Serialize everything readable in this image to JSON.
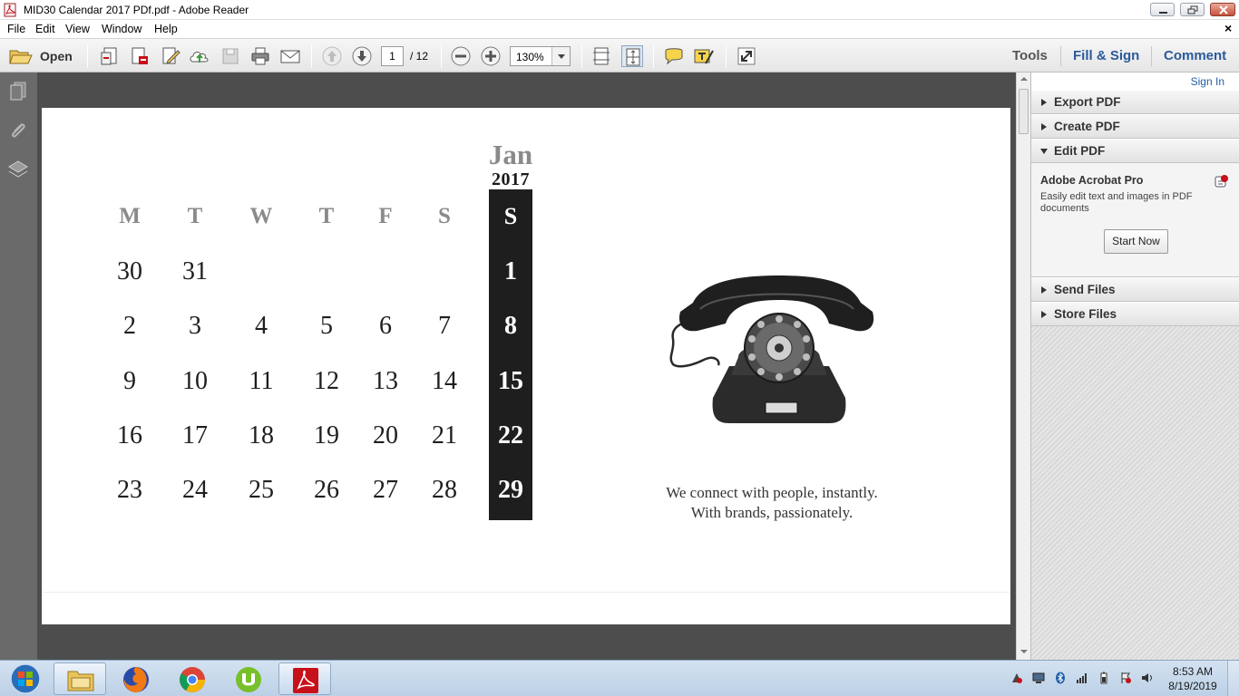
{
  "window": {
    "title": "MID30 Calendar 2017 PDf.pdf - Adobe Reader"
  },
  "menu": {
    "items": [
      "File",
      "Edit",
      "View",
      "Window",
      "Help"
    ],
    "close_glyph": "×"
  },
  "toolbar": {
    "open_label": "Open",
    "page_current": "1",
    "page_total": "/ 12",
    "zoom": "130%",
    "tabs": {
      "tools": "Tools",
      "fill_sign": "Fill & Sign",
      "comment": "Comment"
    }
  },
  "calendar": {
    "month": "Jan",
    "year": "2017",
    "weekdays": [
      "M",
      "T",
      "W",
      "T",
      "F",
      "S"
    ],
    "sunday_header": "S",
    "weeks": [
      [
        "30",
        "31",
        "",
        "",
        "",
        ""
      ],
      [
        "2",
        "3",
        "4",
        "5",
        "6",
        "7"
      ],
      [
        "9",
        "10",
        "11",
        "12",
        "13",
        "14"
      ],
      [
        "16",
        "17",
        "18",
        "19",
        "20",
        "21"
      ],
      [
        "23",
        "24",
        "25",
        "26",
        "27",
        "28"
      ]
    ],
    "sundays": [
      "1",
      "8",
      "15",
      "22",
      "29"
    ],
    "tagline_1": "We connect with people, instantly.",
    "tagline_2": "With brands, passionately."
  },
  "right_panel": {
    "sign_in": "Sign In",
    "sections": {
      "export": "Export PDF",
      "create": "Create PDF",
      "edit": "Edit PDF",
      "send": "Send Files",
      "store": "Store Files"
    },
    "edit_pdf": {
      "product": "Adobe Acrobat Pro",
      "description": "Easily edit text and images in PDF documents",
      "button": "Start Now"
    }
  },
  "taskbar": {
    "apps": [
      "start-orb-icon",
      "file-explorer-icon",
      "firefox-icon",
      "chrome-icon",
      "utorrent-icon",
      "adobe-reader-icon"
    ],
    "time": "8:53 AM",
    "date": "8/19/2019"
  },
  "colors": {
    "accent_blue": "#1f5fa8",
    "calendar_dark": "#1e1e1e",
    "reader_red": "#c8101a"
  }
}
